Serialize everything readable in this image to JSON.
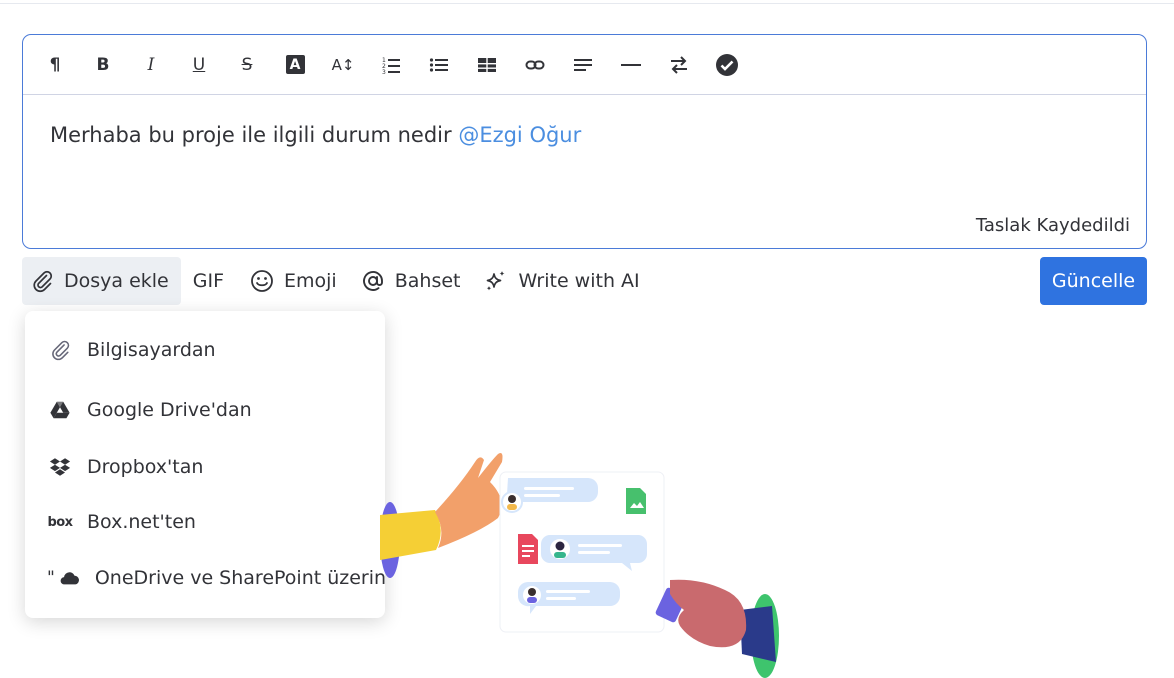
{
  "editor": {
    "body_text": "Merhaba bu proje ile ilgili durum nedir ",
    "mention": "@Ezgi Oğur",
    "draft_status": "Taslak Kaydedildi"
  },
  "toolbar": {
    "paragraph_glyph": "¶",
    "bold_glyph": "B",
    "italic_glyph": "I",
    "underline_glyph": "U",
    "strike_glyph": "S",
    "text_color_glyph": "A",
    "font_size_glyph": "A↕"
  },
  "actions": {
    "attach_label": "Dosya ekle",
    "gif_label": "GIF",
    "emoji_label": "Emoji",
    "mention_label": "Bahset",
    "ai_label": "Write with AI",
    "update_label": "Güncelle"
  },
  "attach_menu": {
    "items": [
      {
        "label": "Bilgisayardan",
        "icon": "paperclip-icon"
      },
      {
        "label": "Google Drive'dan",
        "icon": "google-drive-icon"
      },
      {
        "label": "Dropbox'tan",
        "icon": "dropbox-icon"
      },
      {
        "label": "Box.net'ten",
        "icon": "box-icon",
        "logo_text": "box"
      },
      {
        "label": "OneDrive ve SharePoint üzerinden",
        "icon": "onedrive-icon",
        "prefix": "\""
      }
    ]
  },
  "colors": {
    "accent": "#2f73e0",
    "mention": "#4b8ee0",
    "editor_border": "#4b7bd8"
  }
}
